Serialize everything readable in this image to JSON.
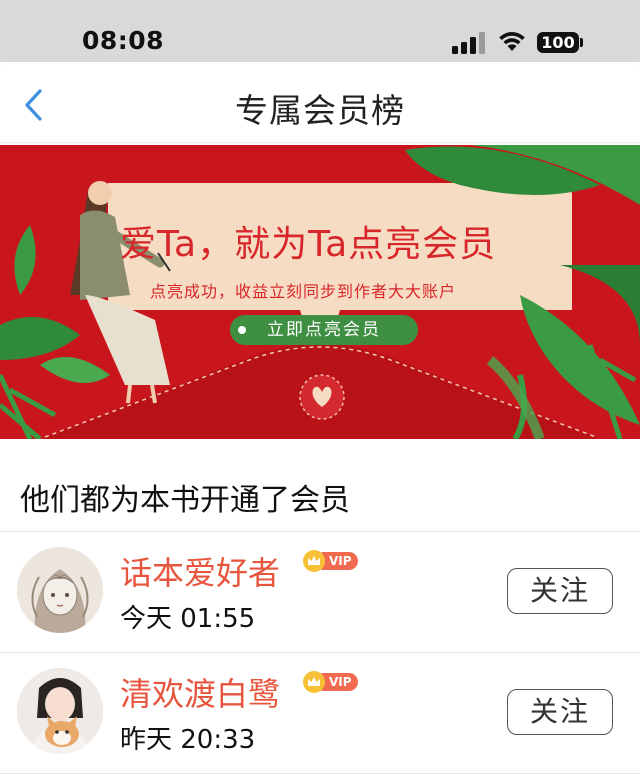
{
  "status_bar": {
    "time": "08:08",
    "battery": "100"
  },
  "nav": {
    "title": "专属会员榜",
    "back_icon": "chevron-left-icon"
  },
  "banner": {
    "headline": "爱Ta，就为Ta点亮会员",
    "subtitle": "点亮成功，收益立刻同步到作者大大账户",
    "cta_label": "立即点亮会员",
    "colors": {
      "background": "#c9161c",
      "card": "#f6dcc2",
      "accent_green": "#3f8f43",
      "text_red": "#d8262b"
    }
  },
  "section": {
    "title": "他们都为本书开通了会员"
  },
  "members": [
    {
      "name": "话本爱好者",
      "badge": "VIP",
      "time": "今天 01:55",
      "follow_label": "关注"
    },
    {
      "name": "清欢渡白鹭",
      "badge": "VIP",
      "time": "昨天 20:33",
      "follow_label": "关注"
    }
  ],
  "colors": {
    "name_color": "#e8553d",
    "nav_accent": "#3d8fe0"
  }
}
